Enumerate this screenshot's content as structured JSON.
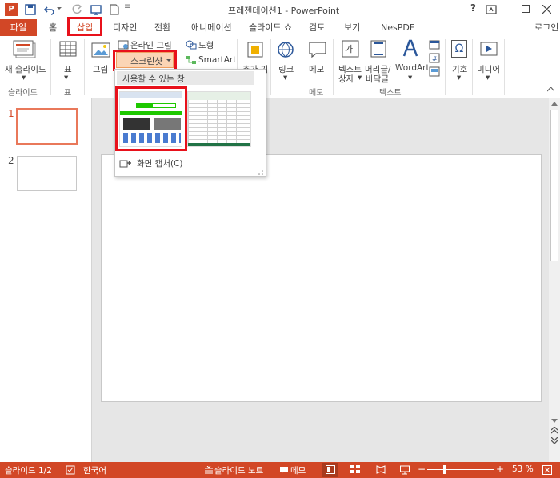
{
  "window": {
    "title": "프레젠테이션1 - PowerPoint",
    "help": "?",
    "login": "로그인"
  },
  "tabs": {
    "file": "파일",
    "home": "홈",
    "insert": "삽입",
    "design": "디자인",
    "transitions": "전환",
    "animations": "애니메이션",
    "slideshow": "슬라이드 쇼",
    "review": "검토",
    "view": "보기",
    "nespdf": "NesPDF"
  },
  "ribbon": {
    "new_slide": "새 슬라이드",
    "new_slide_arrow": "▾",
    "group_slides": "슬라이드",
    "table": "표",
    "table_arrow": "▾",
    "group_tables": "표",
    "picture": "그림",
    "online_picture": "온라인 그림",
    "screenshot": "스크린샷",
    "shapes": "도형",
    "smartart": "SmartArt",
    "addin": "추가 기",
    "link": "링크",
    "link_arrow": "▾",
    "comment": "메모",
    "group_comments": "메모",
    "textbox_l1": "텍스트",
    "textbox_l2": "상자",
    "textbox_arrow": "▾",
    "header_l1": "머리글/",
    "header_l2": "바닥글",
    "wordart": "WordArt",
    "wordart_arrow": "▾",
    "group_text": "텍스트",
    "symbols": "기호",
    "symbols_arrow": "▾",
    "media": "미디어",
    "media_arrow": "▾"
  },
  "dropdown": {
    "header": "사용할 수 있는 창",
    "screen_clipping": "화면 캡처(C)"
  },
  "slides": {
    "num1": "1",
    "num2": "2"
  },
  "status": {
    "slide": "슬라이드 1/2",
    "language": "한국어",
    "notes": "슬라이드 노트",
    "comments": "메모",
    "zoom": "53 %",
    "minus": "−",
    "plus": "+"
  },
  "colors": {
    "accent": "#d24726",
    "highlight": "#e8111b",
    "ribbon_bg": "#ffffff",
    "workspace": "#e6e6e6"
  }
}
